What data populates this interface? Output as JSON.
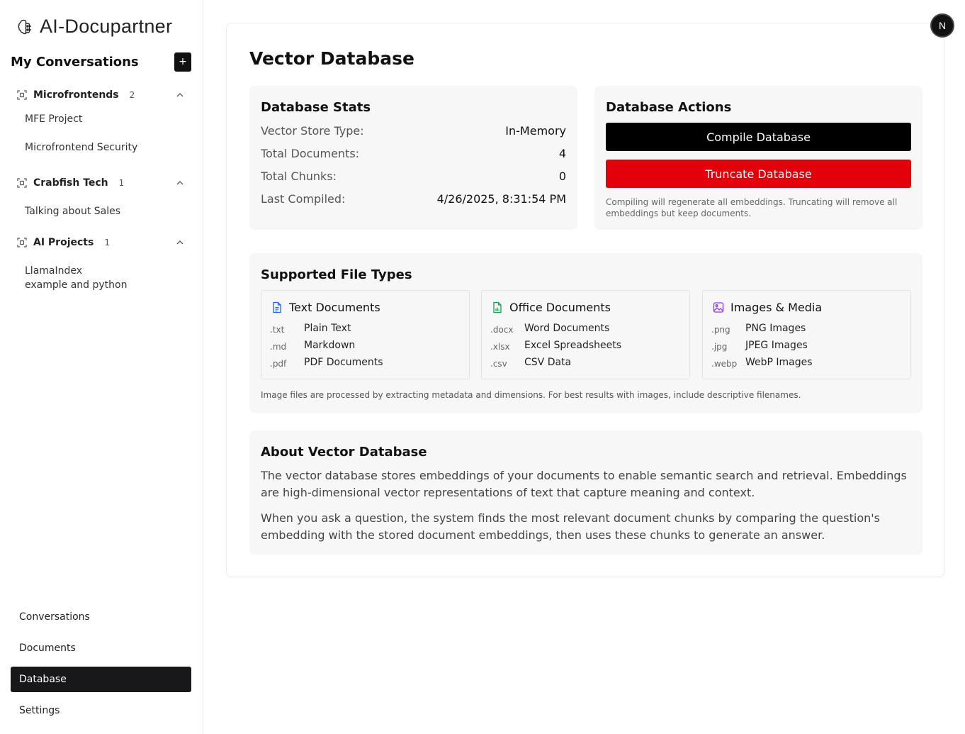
{
  "app": {
    "name": "AI-Docupartner",
    "avatar_letter": "N"
  },
  "sidebar": {
    "conversations_title": "My Conversations",
    "new_button": "+",
    "groups": [
      {
        "name": "Microfrontends",
        "count": "2",
        "items": [
          "MFE Project",
          "Microfrontend Security"
        ]
      },
      {
        "name": "Crabfish Tech",
        "count": "1",
        "items": [
          "Talking about Sales"
        ]
      },
      {
        "name": "AI Projects",
        "count": "1",
        "items": [
          "LlamaIndex example and python"
        ]
      }
    ],
    "nav": [
      {
        "label": "Conversations",
        "active": false
      },
      {
        "label": "Documents",
        "active": false
      },
      {
        "label": "Database",
        "active": true
      },
      {
        "label": "Settings",
        "active": false
      }
    ]
  },
  "main": {
    "title": "Vector Database",
    "stats": {
      "title": "Database Stats",
      "rows": [
        {
          "label": "Vector Store Type:",
          "value": "In-Memory"
        },
        {
          "label": "Total Documents:",
          "value": "4"
        },
        {
          "label": "Total Chunks:",
          "value": "0"
        },
        {
          "label": "Last Compiled:",
          "value": "4/26/2025, 8:31:54 PM"
        }
      ]
    },
    "actions": {
      "title": "Database Actions",
      "compile_label": "Compile Database",
      "truncate_label": "Truncate Database",
      "note": "Compiling will regenerate all embeddings. Truncating will remove all embeddings but keep documents."
    },
    "file_types": {
      "title": "Supported File Types",
      "groups": [
        {
          "title": "Text Documents",
          "icon": "document-text-icon",
          "color": "#2563eb",
          "rows": [
            {
              "ext": ".txt",
              "desc": "Plain Text"
            },
            {
              "ext": ".md",
              "desc": "Markdown"
            },
            {
              "ext": ".pdf",
              "desc": "PDF Documents"
            }
          ]
        },
        {
          "title": "Office Documents",
          "icon": "spreadsheet-chart-icon",
          "color": "#16a34a",
          "rows": [
            {
              "ext": ".docx",
              "desc": "Word Documents"
            },
            {
              "ext": ".xlsx",
              "desc": "Excel Spreadsheets"
            },
            {
              "ext": ".csv",
              "desc": "CSV Data"
            }
          ]
        },
        {
          "title": "Images & Media",
          "icon": "image-icon",
          "color": "#9333ea",
          "rows": [
            {
              "ext": ".png",
              "desc": "PNG Images"
            },
            {
              "ext": ".jpg",
              "desc": "JPEG Images"
            },
            {
              "ext": ".webp",
              "desc": "WebP Images"
            }
          ]
        }
      ],
      "note": "Image files are processed by extracting metadata and dimensions. For best results with images, include descriptive filenames."
    },
    "about": {
      "title": "About Vector Database",
      "p1": "The vector database stores embeddings of your documents to enable semantic search and retrieval. Embeddings are high-dimensional vector representations of text that capture meaning and context.",
      "p2": "When you ask a question, the system finds the most relevant document chunks by comparing the question's embedding with the stored document embeddings, then uses these chunks to generate an answer."
    }
  }
}
